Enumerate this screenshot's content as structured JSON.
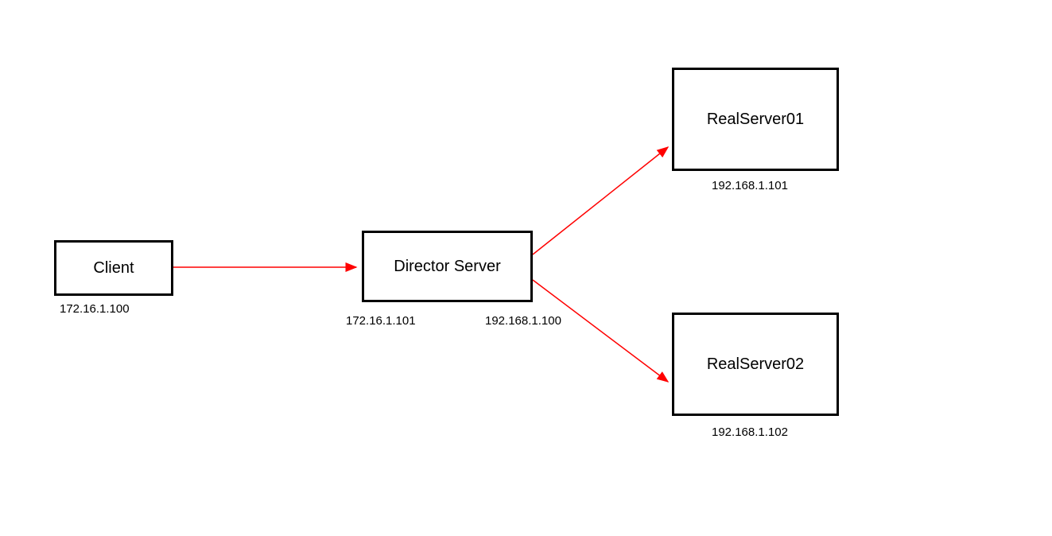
{
  "nodes": {
    "client": {
      "label": "Client",
      "ip": "172.16.1.100"
    },
    "director": {
      "label": "Director Server",
      "ip_left": "172.16.1.101",
      "ip_right": "192.168.1.100"
    },
    "rs1": {
      "label": "RealServer01",
      "ip": "192.168.1.101"
    },
    "rs2": {
      "label": "RealServer02",
      "ip": "192.168.1.102"
    }
  }
}
